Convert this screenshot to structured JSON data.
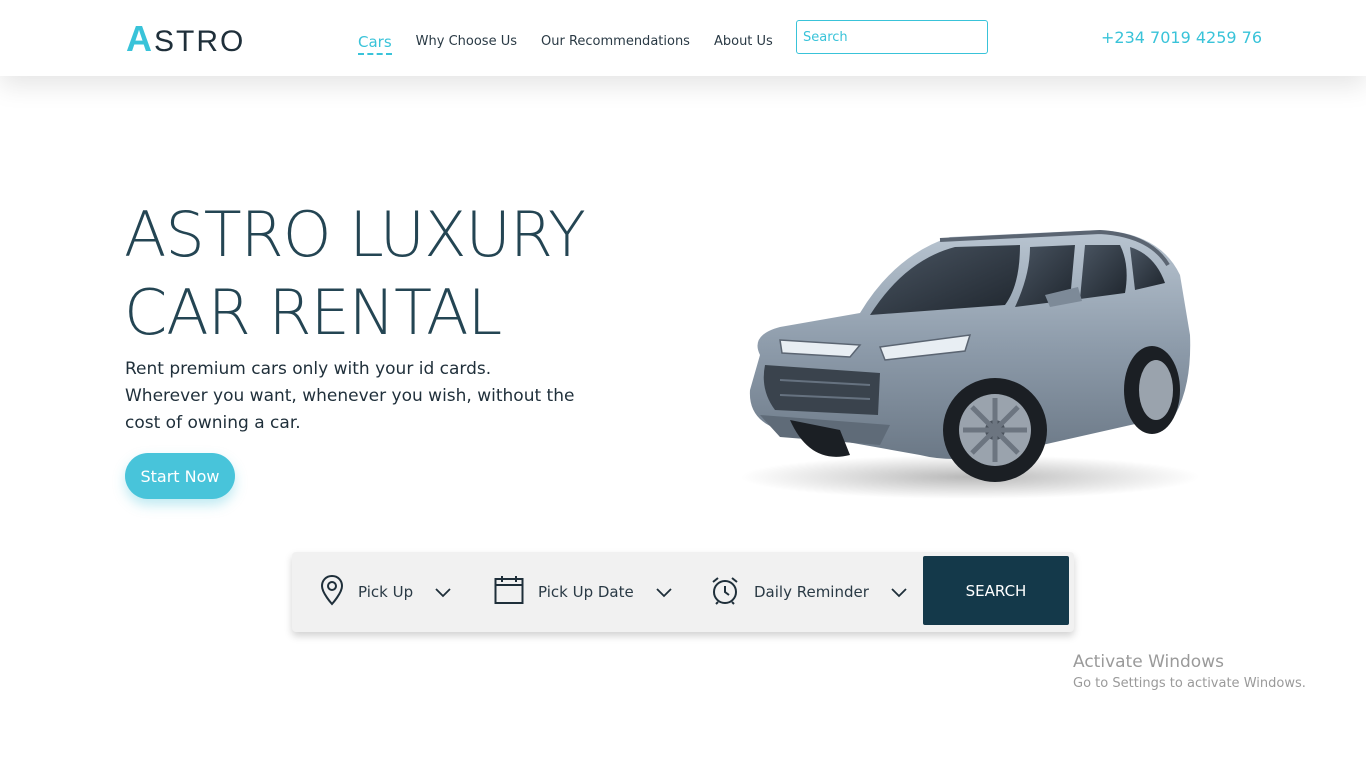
{
  "header": {
    "logo_first": "A",
    "logo_rest": "STRO",
    "nav": [
      {
        "label": "Cars"
      },
      {
        "label": "Why Choose Us"
      },
      {
        "label": "Our Recommendations"
      },
      {
        "label": "About Us"
      }
    ],
    "search_placeholder": "Search",
    "phone": "+234 7019 4259 76"
  },
  "hero": {
    "title_line1": "ASTRO LUXURY",
    "title_line2": "CAR RENTAL",
    "subtitle_line1": "Rent premium cars only with your id cards.",
    "subtitle_line2": "Wherever you want, whenever you wish, without the",
    "subtitle_line3": "cost of owning a car.",
    "cta_label": "Start Now",
    "car_image": "silver-suv"
  },
  "booking": {
    "fields": [
      {
        "label": "Pick Up",
        "icon": "location-pin-icon"
      },
      {
        "label": "Pick Up Date",
        "icon": "calendar-icon"
      },
      {
        "label": "Daily Reminder",
        "icon": "alarm-clock-icon"
      }
    ],
    "search_label": "SEARCH"
  },
  "watermark": {
    "title": "Activate Windows",
    "subtitle": "Go to Settings to activate Windows."
  },
  "colors": {
    "accent": "#39c3d9",
    "heading": "#244553",
    "dark_button": "#14394a"
  }
}
